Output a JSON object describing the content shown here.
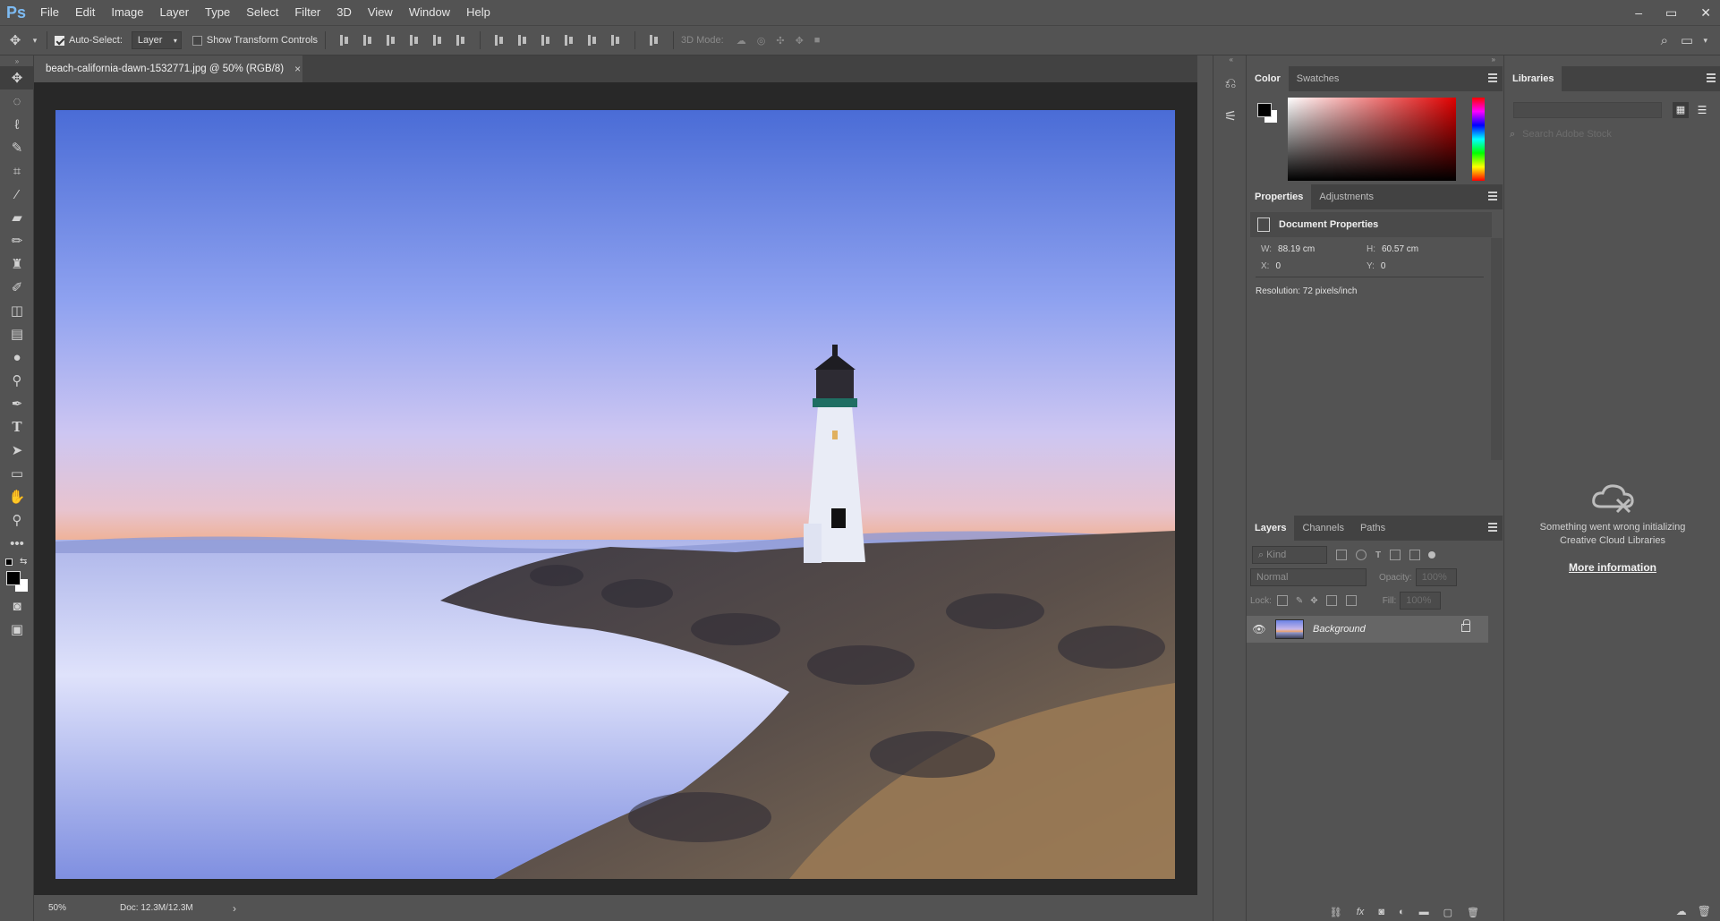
{
  "app": {
    "logo": "Ps"
  },
  "menu": [
    "File",
    "Edit",
    "Image",
    "Layer",
    "Type",
    "Select",
    "Filter",
    "3D",
    "View",
    "Window",
    "Help"
  ],
  "window_controls": {
    "minimize": "–",
    "restore": "▭",
    "close": "✕"
  },
  "options_bar": {
    "auto_select_label": "Auto-Select:",
    "auto_select_checked": true,
    "auto_select_value": "Layer",
    "show_transform_label": "Show Transform Controls",
    "show_transform_checked": false,
    "mode_3d_label": "3D Mode:"
  },
  "document": {
    "tab_title": "beach-california-dawn-1532771.jpg @ 50% (RGB/8)",
    "tab_close": "×",
    "status_zoom": "50%",
    "status_doc": "Doc: 12.3M/12.3M",
    "status_arrow": "›"
  },
  "color_panel": {
    "tabs": [
      "Color",
      "Swatches"
    ],
    "foreground": "#000000",
    "background": "#ffffff"
  },
  "properties_panel": {
    "tabs": [
      "Properties",
      "Adjustments"
    ],
    "title": "Document Properties",
    "w_label": "W:",
    "w_value": "88.19 cm",
    "h_label": "H:",
    "h_value": "60.57 cm",
    "x_label": "X:",
    "x_value": "0",
    "y_label": "Y:",
    "y_value": "0",
    "resolution": "Resolution: 72 pixels/inch"
  },
  "layers_panel": {
    "tabs": [
      "Layers",
      "Channels",
      "Paths"
    ],
    "kind_placeholder": "Kind",
    "blend_mode": "Normal",
    "opacity_label": "Opacity:",
    "opacity_value": "100%",
    "lock_label": "Lock:",
    "fill_label": "Fill:",
    "fill_value": "100%",
    "layer_name": "Background",
    "footer_fx": "fx"
  },
  "libraries": {
    "tab": "Libraries",
    "search_placeholder": "Search Adobe Stock",
    "error_line1": "Something went wrong initializing",
    "error_line2": "Creative Cloud Libraries",
    "more_info": "More information"
  }
}
